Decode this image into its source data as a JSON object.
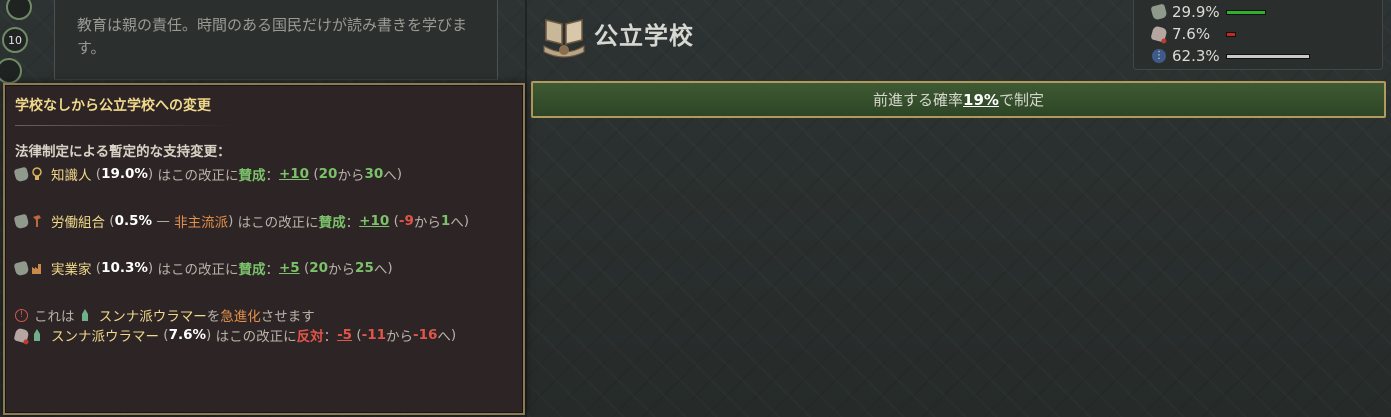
{
  "description": {
    "text": "教育は親の責任。時間のある国民だけが読み書きを学びます。"
  },
  "left_strip": {
    "badge_count": "10"
  },
  "law": {
    "title": "公立学校",
    "icon": "books-hand-icon"
  },
  "support": {
    "rows": [
      {
        "icon": "thumbs-up-icon",
        "value": "29.9%",
        "fraction": 0.299,
        "color": "#2fae2f"
      },
      {
        "icon": "thumbs-down-icon",
        "value": "7.6%",
        "fraction": 0.076,
        "color": "#c52a20"
      },
      {
        "icon": "info-icon",
        "value": "62.3%",
        "fraction": 0.623,
        "color": "#c9c9c9"
      }
    ]
  },
  "enact_button": {
    "prefix": "前進する確率",
    "pct": "19%",
    "suffix": "で制定"
  },
  "tooltip": {
    "title": "学校なしから公立学校への変更",
    "heading": "法律制定による暫定的な支持変更：",
    "groups": [
      {
        "name": "知識人",
        "share": "19.0%",
        "mid": "はこの改正に",
        "stance": "賛成",
        "colon": "：",
        "delta": "+10",
        "from": "20",
        "kara": "から",
        "to": "30",
        "he": "へ"
      },
      {
        "name": "労働組合",
        "share": "0.5%",
        "dash": "—",
        "faction": "非主流派",
        "mid": "はこの改正に",
        "stance": "賛成",
        "colon": "：",
        "delta": "+10",
        "from": "-9",
        "kara": "から",
        "to": "1",
        "he": "へ"
      },
      {
        "name": "実業家",
        "share": "10.3%",
        "mid": "はこの改正に",
        "stance": "賛成",
        "colon": "：",
        "delta": "+5",
        "from": "20",
        "kara": "から",
        "to": "25",
        "he": "へ"
      }
    ],
    "radical": {
      "pre": "これは",
      "movement": "スンナ派ウラマー",
      "wo": "を",
      "action": "急進化",
      "post": "させます"
    },
    "opposition": {
      "name": "スンナ派ウラマー",
      "share": "7.6%",
      "mid": "はこの改正に",
      "stance": "反対",
      "colon": "：",
      "delta": "-5",
      "from": "-11",
      "kara": "から",
      "to": "-16",
      "he": "へ"
    }
  }
}
